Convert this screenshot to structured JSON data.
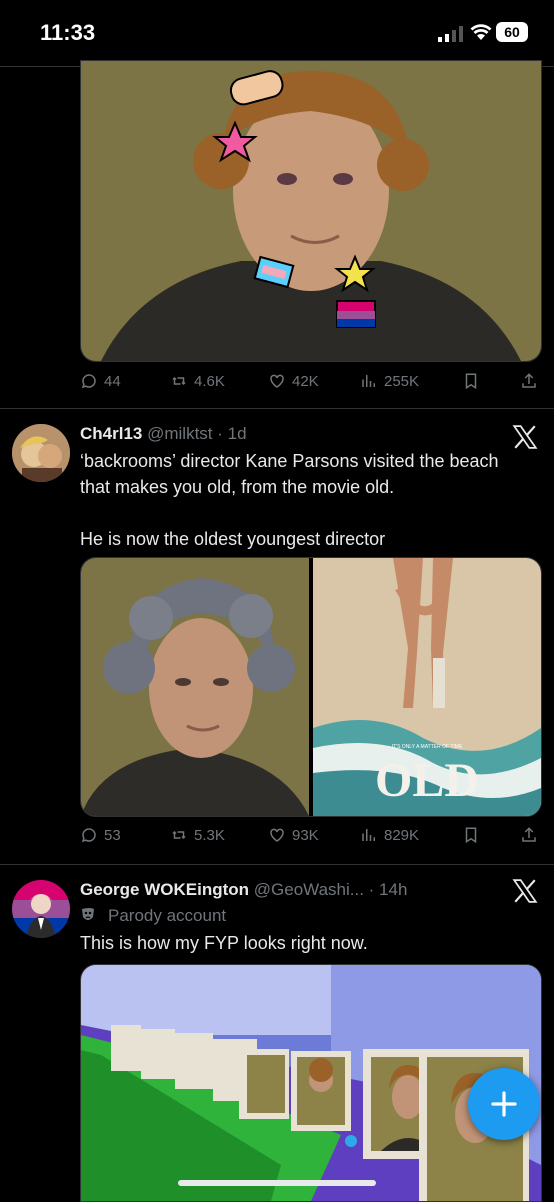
{
  "status_bar": {
    "time": "11:33",
    "battery": "60"
  },
  "tweet1": {
    "stats": {
      "replies": "44",
      "reposts": "4.6K",
      "likes": "42K",
      "views": "255K"
    }
  },
  "tweet2": {
    "display_name": "Ch4rl13",
    "handle": "@milktst · 1d",
    "text": "‘backrooms’ director Kane Parsons visited the beach that makes you old, from the movie old.\n\nHe is now the oldest youngest director",
    "poster_title": "OLD",
    "poster_tagline": "IT'S ONLY A MATTER OF TIME",
    "stats": {
      "replies": "53",
      "reposts": "5.3K",
      "likes": "93K",
      "views": "829K"
    }
  },
  "tweet3": {
    "display_name": "George WOKEington",
    "handle": "@GeoWashi... · 14h",
    "parody_label": "Parody account",
    "text": "This is how my FYP looks right now."
  },
  "icons": {
    "reply": "reply-icon",
    "repost": "repost-icon",
    "like": "heart-icon",
    "views": "views-icon",
    "bookmark": "bookmark-icon",
    "share": "share-icon",
    "compose": "plus-icon",
    "x_logo": "x-logo-icon",
    "parody": "theater-masks-icon"
  },
  "colors": {
    "background": "#000000",
    "text": "#e7e9ea",
    "muted": "#71767b",
    "accent": "#1d9bf0",
    "divider": "#2f3336"
  }
}
